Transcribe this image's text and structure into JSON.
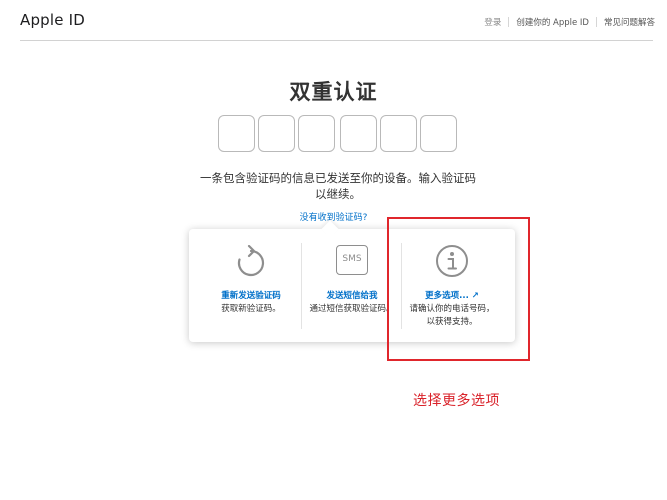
{
  "header": {
    "brand": "Apple ID",
    "nav": {
      "sign_in": "登录",
      "create": "创建你的 Apple ID",
      "faq": "常见问题解答"
    }
  },
  "main": {
    "title": "双重认证",
    "code_digits": [
      "",
      "",
      "",
      "",
      "",
      ""
    ],
    "description": "一条包含验证码的信息已发送至你的设备。输入验证码以继续。",
    "no_code_link": "没有收到验证码?"
  },
  "options": {
    "resend": {
      "title": "重新发送验证码",
      "desc": "获取新验证码。",
      "icon": "refresh-icon"
    },
    "sms": {
      "title": "发送短信给我",
      "desc": "通过短信获取验证码。",
      "icon_text": "SMS",
      "icon": "sms-icon"
    },
    "more": {
      "title": "更多选项... ↗",
      "desc": "请确认你的电话号码，以获得支持。",
      "icon": "info-icon"
    }
  },
  "annotation": {
    "text": "选择更多选项",
    "color": "#e0262c"
  },
  "colors": {
    "link": "#0070c9",
    "text": "#333333"
  }
}
